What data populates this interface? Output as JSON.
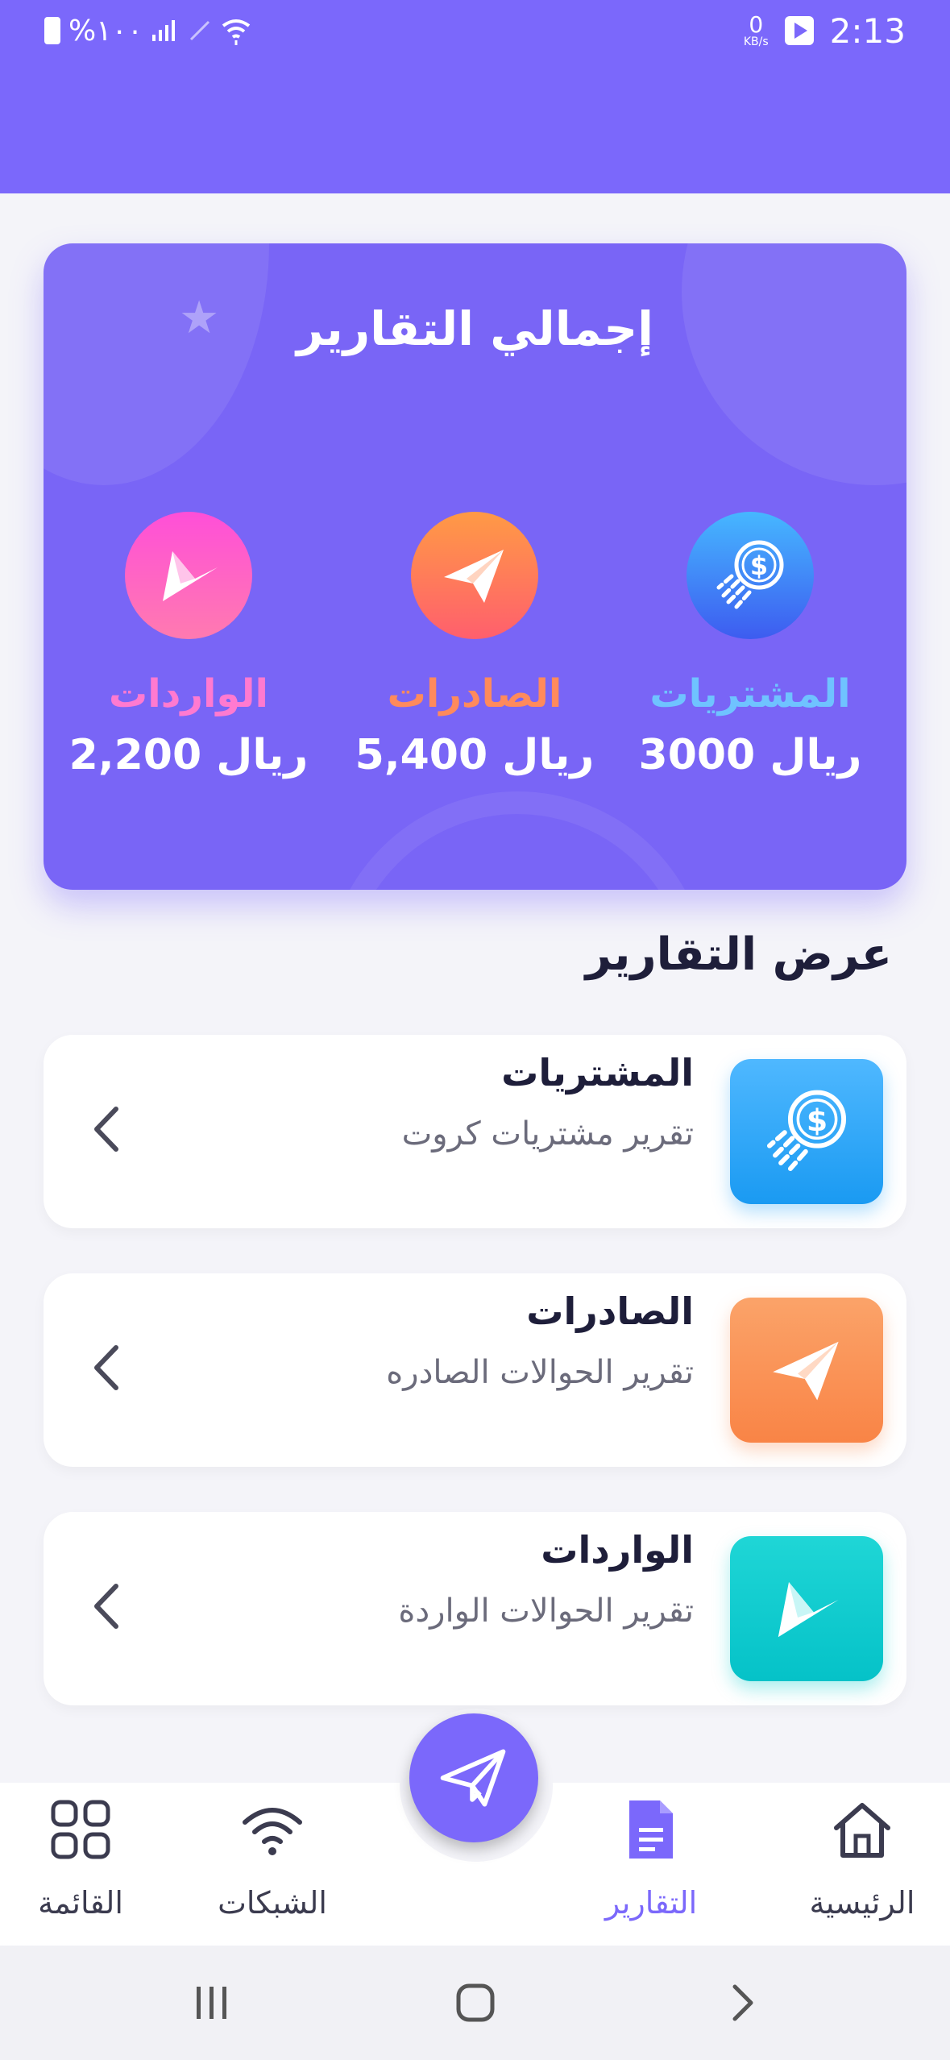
{
  "status_bar": {
    "battery_text": "%١٠٠",
    "time": "2:13",
    "net_speed_value": "0",
    "net_speed_unit": "KB/s"
  },
  "summary": {
    "title": "إجمالي التقارير",
    "stats": [
      {
        "label": "المشتريات",
        "value": "3000 ريال",
        "label_color": "#6fc3ff",
        "icon": "dollar-coin-icon"
      },
      {
        "label": "الصادرات",
        "value": "5,400 ريال",
        "label_color": "#ff8a5c",
        "icon": "paper-plane-icon"
      },
      {
        "label": "الواردات",
        "value": "2,200 ريال",
        "label_color": "#ff7ad0",
        "icon": "incoming-plane-icon"
      }
    ]
  },
  "section": {
    "title": "عرض التقارير"
  },
  "reports": [
    {
      "title": "المشتريات",
      "subtitle": "تقرير مشتريات كروت",
      "icon": "dollar-coin-icon",
      "color": "#2fa7f5"
    },
    {
      "title": "الصادرات",
      "subtitle": "تقرير الحوالات الصادره",
      "icon": "paper-plane-icon",
      "color": "#f98e55"
    },
    {
      "title": "الواردات",
      "subtitle": "تقرير الحوالات الواردة",
      "icon": "incoming-plane-icon",
      "color": "#0fcfcf"
    }
  ],
  "bottom_nav": {
    "items": [
      {
        "label": "الرئيسية",
        "icon": "home-icon"
      },
      {
        "label": "التقارير",
        "icon": "document-icon",
        "active": true
      },
      {
        "label": "الشبكات",
        "icon": "wifi-icon"
      },
      {
        "label": "القائمة",
        "icon": "grid-menu-icon"
      }
    ],
    "fab_icon": "paper-plane-icon"
  },
  "colors": {
    "primary": "#7b68fb",
    "card": "#7965f6",
    "background": "#f4f4f9"
  }
}
